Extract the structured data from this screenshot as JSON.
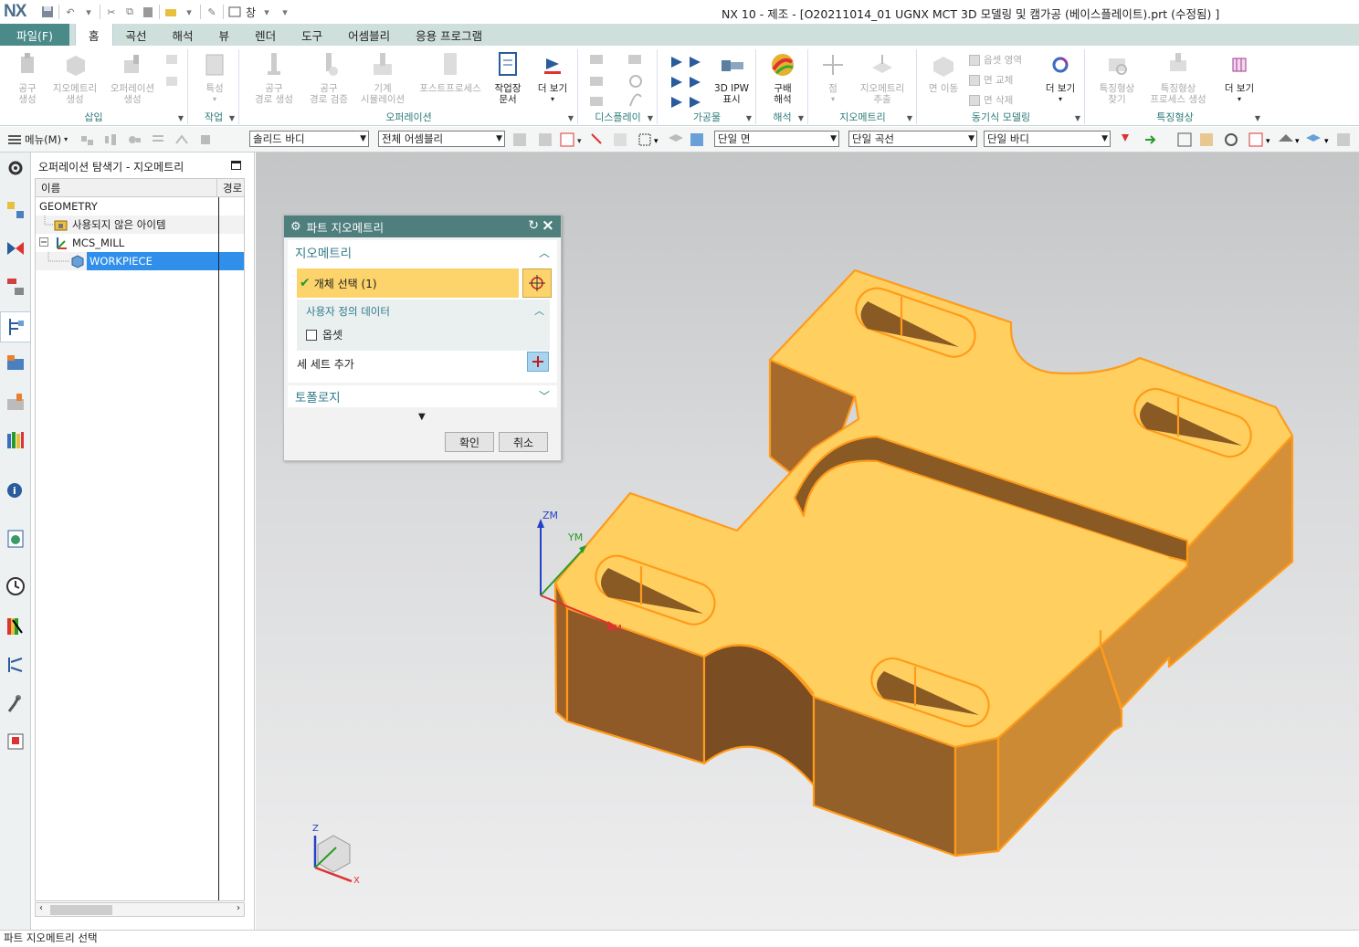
{
  "app": {
    "logo": "NX",
    "title": "NX 10 - 제조 - [O20211014_01 UGNX MCT 3D 모델링 및 캠가공 (베이스플레이트).prt (수정됨) ]",
    "window_menu": "창"
  },
  "ribbon": {
    "file_tab": "파일(F)",
    "tabs": [
      "홈",
      "곡선",
      "해석",
      "뷰",
      "렌더",
      "도구",
      "어셈블리",
      "응용 프로그램"
    ],
    "active_tab": "홈",
    "groups": {
      "insert": "삽입",
      "work": "작업",
      "operation": "오퍼레이션",
      "display": "디스플레이",
      "workpiece": "가공물",
      "analysis": "해석",
      "geometry": "지오메트리",
      "sync_modeling": "동기식 모델링",
      "feature": "특징형상"
    },
    "buttons": {
      "create_tool": "공구\n생성",
      "create_geometry": "지오메트리\n생성",
      "create_operation": "오퍼레이션\n생성",
      "properties": "특성",
      "gen_toolpath": "공구\n경로 생성",
      "verify_toolpath": "공구\n경로 검증",
      "machine_sim": "기계\n시뮬레이션",
      "postprocess": "포스트프로세스",
      "shop_doc": "작업장\n문서",
      "more1": "더 보기",
      "ipw": "3D IPW\n표시",
      "gradient": "구배\n해석",
      "point": "점",
      "extract_geom": "지오메트리\n추출",
      "move_face": "면 이동",
      "offset_region": "옵셋 영역",
      "replace_face": "면 교체",
      "delete_face": "면 삭제",
      "more2": "더 보기",
      "find_feature": "특징형상\n찾기",
      "feature_process": "특징형상\n프로세스 생성",
      "more3": "더 보기"
    }
  },
  "selection_bar": {
    "menu_label": "메뉴(M)",
    "filter_type": "솔리드 바디",
    "scope": "전체 어셈블리",
    "face_rule": "단일 면",
    "curve_rule": "단일 곡선",
    "body_rule": "단일 바디"
  },
  "navigator": {
    "title": "오퍼레이션 탐색기 - 지오메트리",
    "columns": [
      "이름",
      "경로"
    ],
    "tree": [
      {
        "label": "GEOMETRY",
        "level": 0,
        "selected": false
      },
      {
        "label": "사용되지 않은 아이템",
        "level": 1,
        "selected": false
      },
      {
        "label": "MCS_MILL",
        "level": 1,
        "selected": false
      },
      {
        "label": "WORKPIECE",
        "level": 2,
        "selected": true
      }
    ]
  },
  "dialog": {
    "title": "파트 지오메트리",
    "section_geometry": "지오메트리",
    "select_object": "개체 선택 (1)",
    "userdata_title": "사용자 정의 데이터",
    "offset_label": "옵셋",
    "offset_checked": false,
    "add_new_set": "세 세트 추가",
    "section_topology": "토폴로지",
    "ok": "확인",
    "cancel": "취소"
  },
  "graphics": {
    "wcs_labels": {
      "z": "ZM",
      "y": "YM",
      "x": "XM"
    },
    "triad_labels": {
      "z": "Z",
      "x": "X"
    }
  },
  "colors": {
    "part_top": "#ffd060",
    "part_side": "#c98630",
    "part_edge": "#ff9b1a",
    "ribbon_accent": "#4a8a88"
  },
  "statusbar": {
    "text": "파트 지오메트리 선택"
  }
}
